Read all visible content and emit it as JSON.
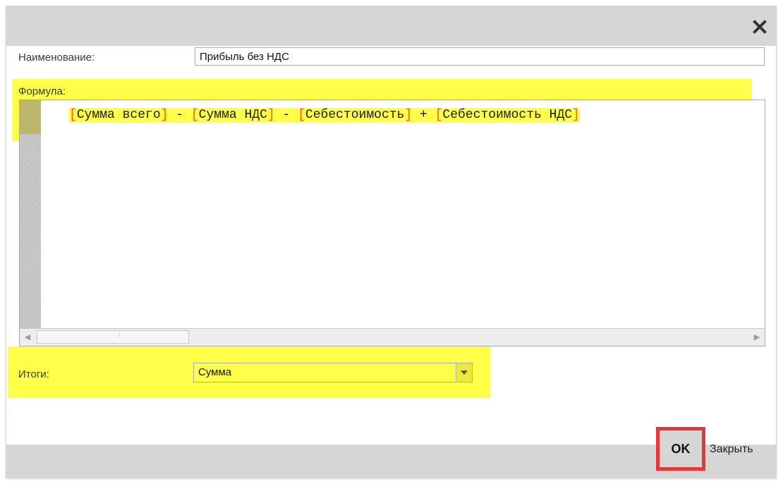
{
  "dialog": {
    "close_icon": "close-icon",
    "name_label": "Наименование:",
    "name_value": "Прибыль без НДС",
    "formula_label": "Формула:",
    "formula_tokens": [
      {
        "t": "[",
        "bracket": true
      },
      {
        "t": "Сумма всего",
        "bracket": false
      },
      {
        "t": "]",
        "bracket": true
      },
      {
        "t": " - ",
        "bracket": false
      },
      {
        "t": "[",
        "bracket": true
      },
      {
        "t": "Сумма НДС",
        "bracket": false
      },
      {
        "t": "]",
        "bracket": true
      },
      {
        "t": " - ",
        "bracket": false
      },
      {
        "t": "[",
        "bracket": true
      },
      {
        "t": "Себестоимость",
        "bracket": false
      },
      {
        "t": "]",
        "bracket": true
      },
      {
        "t": " + ",
        "bracket": false
      },
      {
        "t": "[",
        "bracket": true
      },
      {
        "t": "Себестоимость НДС",
        "bracket": false
      },
      {
        "t": "]",
        "bracket": true
      }
    ],
    "totals_label": "Итоги:",
    "totals_value": "Сумма",
    "ok_label": "OK",
    "close_label": "Закрыть"
  },
  "colors": {
    "highlight": "#ffff4a",
    "bracket": "#ff5a00",
    "ok_border": "#e53939"
  }
}
